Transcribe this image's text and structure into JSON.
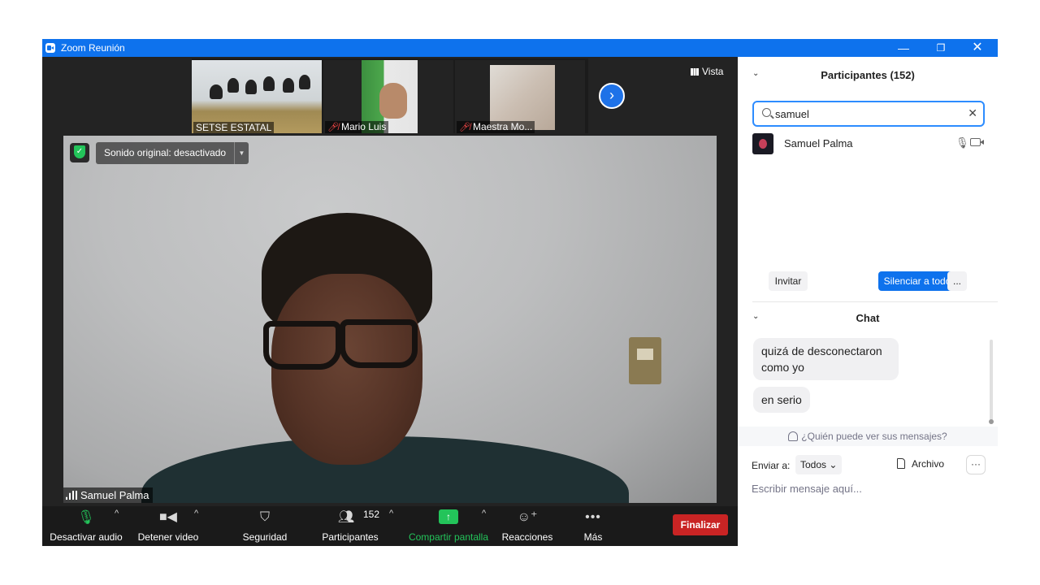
{
  "window": {
    "title": "Zoom Reunión",
    "minimize_glyph": "—",
    "maximize_glyph": "❐",
    "close_glyph": "✕"
  },
  "gallery": {
    "thumbnails": [
      {
        "name": "SETSE ESTATAL",
        "muted": false
      },
      {
        "name": "Mario Luis",
        "muted": true
      },
      {
        "name": "Maestra Mo...",
        "muted": true
      }
    ],
    "next_icon": "chevron-right-icon",
    "view_label": "Vista"
  },
  "main_video": {
    "original_sound": "Sonido original: desactivado",
    "speaker_name": "Samuel Palma"
  },
  "toolbar": {
    "audio_label": "Desactivar audio",
    "video_label": "Detener video",
    "security_label": "Seguridad",
    "participants_label": "Participantes",
    "participants_count": "152",
    "share_label": "Compartir pantalla",
    "reactions_label": "Reacciones",
    "more_label": "Más",
    "end_label": "Finalizar",
    "share_color": "#23c45a",
    "end_color": "#c92424"
  },
  "participants_panel": {
    "title": "Participantes (152)",
    "search_value": "samuel",
    "results": [
      {
        "name": "Samuel Palma"
      }
    ],
    "invite_label": "Invitar",
    "mute_all_label": "Silenciar a todos",
    "more_label": "..."
  },
  "chat_panel": {
    "title": "Chat",
    "messages": [
      {
        "text": "quizá de desconectaron como yo"
      },
      {
        "text": "en serio"
      }
    ],
    "who_can_see": "¿Quién puede ver sus mensajes?",
    "send_to_label": "Enviar a:",
    "send_to_value": "Todos",
    "file_label": "Archivo",
    "input_placeholder": "Escribir mensaje aquí...",
    "accent_color": "#0e72ed"
  }
}
